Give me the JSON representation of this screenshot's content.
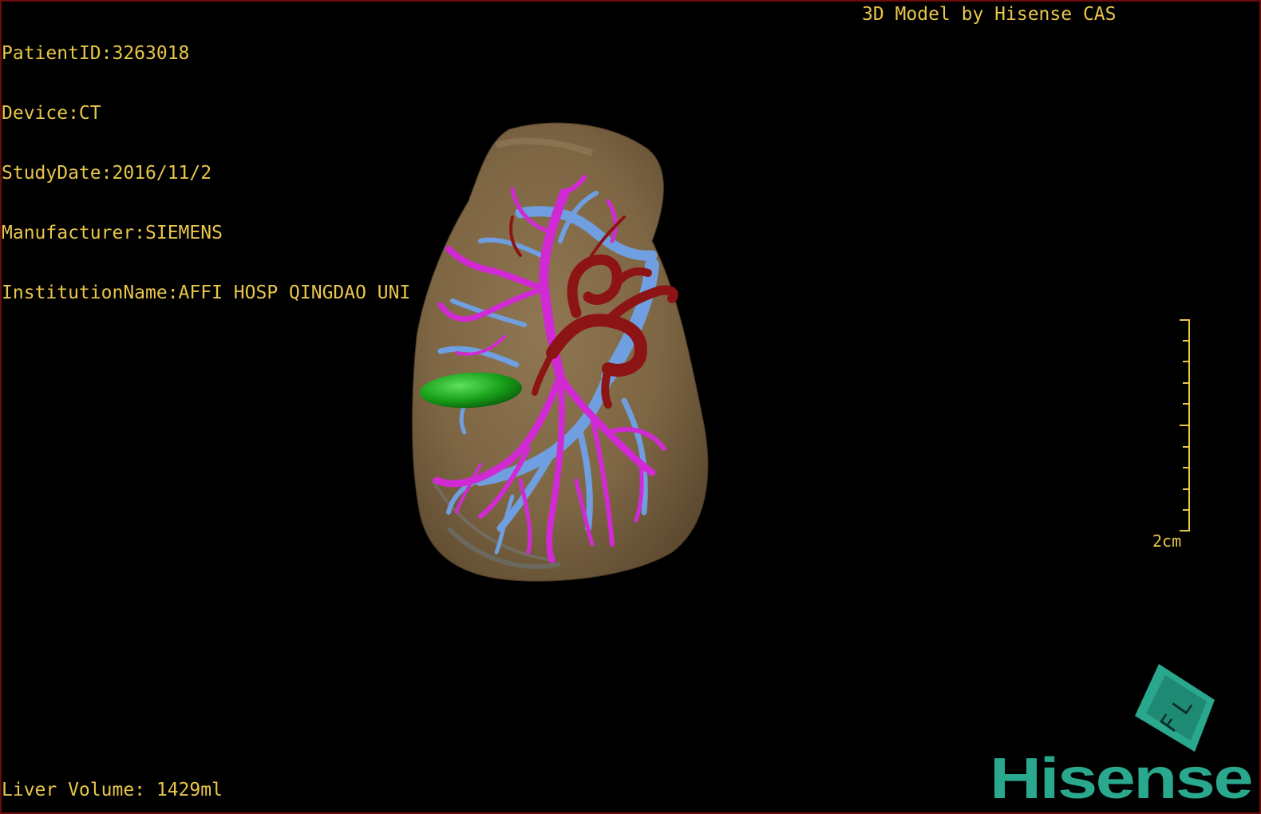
{
  "info": {
    "patient_id": "PatientID:3263018",
    "device": "Device:CT",
    "study_date": "StudyDate:2016/11/2",
    "manufacturer": "Manufacturer:SIEMENS",
    "institution": "InstitutionName:AFFI HOSP QINGDAO UNI"
  },
  "credit": "3D Model by Hisense CAS",
  "liver_volume": "Liver Volume: 1429ml",
  "scale": {
    "label": "2cm"
  },
  "logo": {
    "wordmark": "Hisense",
    "mark_letters": "F L"
  },
  "colors": {
    "overlay_text": "#e8c64a",
    "liver": "#8a6f4a",
    "portal_vein": "#d12ad4",
    "hepatic_vein": "#6f9fe0",
    "artery": "#8c1414",
    "gallbladder": "#1fa51f",
    "logo_teal": "#2aa88e",
    "frame": "#6b0d0d"
  }
}
